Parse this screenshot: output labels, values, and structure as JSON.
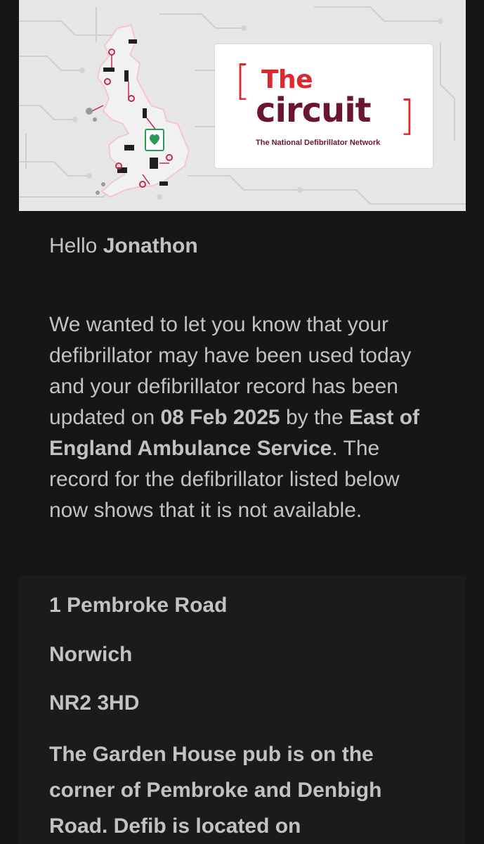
{
  "banner": {
    "logo": {
      "word1": "The",
      "word2": "circuit",
      "tagline": "The National Defibrillator Network",
      "colors": {
        "accent": "#e1262d",
        "brand": "#6b1535"
      }
    },
    "map_icon": "uk-circuit-map-icon",
    "defib_icon": "defibrillator-heart-icon"
  },
  "greeting": {
    "hello": "Hello",
    "name": "Jonathon"
  },
  "message": {
    "part1": "We wanted to let you know that your defibrillator may have been used today and your defibrillator record has been updated on ",
    "date": "08 Feb 2025",
    "part2": " by the ",
    "service": "East of England Ambulance Service",
    "part3": ". The record for the defibrillator listed below now shows that it is not available."
  },
  "address": {
    "line1": "1 Pembroke Road",
    "city": "Norwich",
    "postcode": "NR2 3HD",
    "description": "The Garden House pub is on the corner of Pembroke and Denbigh Road. Defib is located on"
  }
}
